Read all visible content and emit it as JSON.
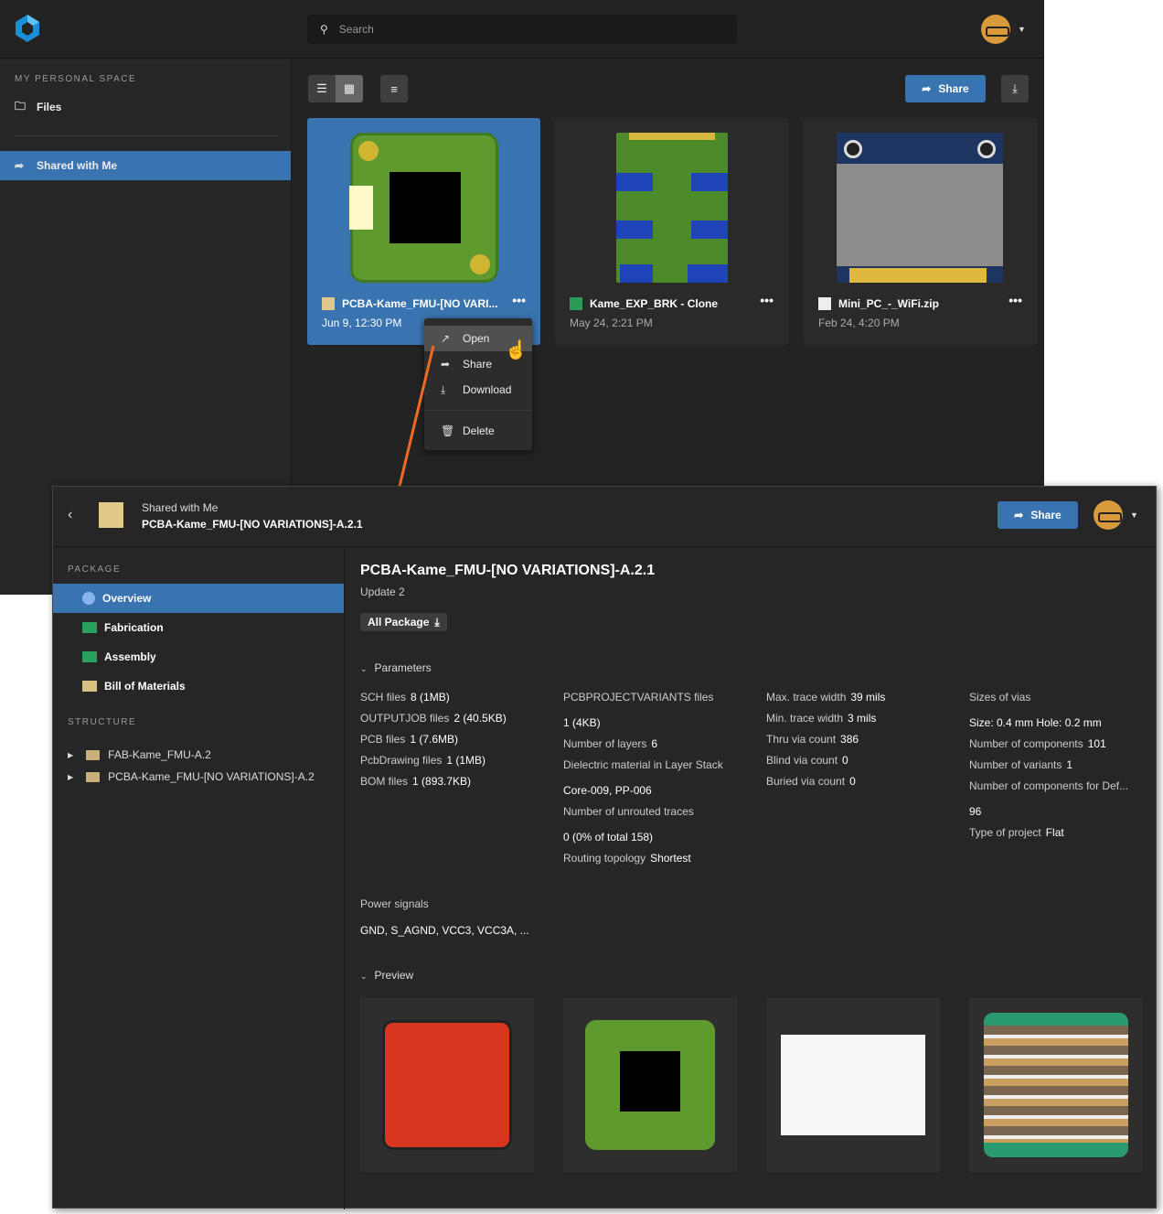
{
  "topbar": {
    "search_placeholder": "Search"
  },
  "sidebar": {
    "section": "MY PERSONAL SPACE",
    "files": "Files",
    "shared": "Shared with Me"
  },
  "toolbar": {
    "share": "Share"
  },
  "cards": [
    {
      "name": "PCBA-Kame_FMU-[NO VARI...",
      "date": "Jun 9, 12:30 PM",
      "selected": true
    },
    {
      "name": "Kame_EXP_BRK - Clone",
      "date": "May 24, 2:21 PM"
    },
    {
      "name": "Mini_PC_-_WiFi.zip",
      "date": "Feb 24, 4:20 PM"
    }
  ],
  "menu": [
    "Open",
    "Share",
    "Download",
    "Delete"
  ],
  "detail": {
    "breadcrumb_parent": "Shared with Me",
    "breadcrumb_title": "PCBA-Kame_FMU-[NO VARIATIONS]-A.2.1",
    "share": "Share",
    "package_label": "PACKAGE",
    "nav": [
      "Overview",
      "Fabrication",
      "Assembly",
      "Bill of Materials"
    ],
    "structure_label": "STRUCTURE",
    "tree": [
      "FAB-Kame_FMU-A.2",
      "PCBA-Kame_FMU-[NO VARIATIONS]-A.2"
    ],
    "title": "PCBA-Kame_FMU-[NO VARIATIONS]-A.2.1",
    "subtitle": "Update 2",
    "all_package": "All Package",
    "parameters_label": "Parameters",
    "preview_label": "Preview",
    "col1": [
      [
        "SCH files",
        "8 (1MB)"
      ],
      [
        "OUTPUTJOB files",
        "2 (40.5KB)"
      ],
      [
        "PCB files",
        "1 (7.6MB)"
      ],
      [
        "PcbDrawing files",
        "1 (1MB)"
      ],
      [
        "BOM files",
        "1 (893.7KB)"
      ]
    ],
    "col2": {
      "a_label": "PCBPROJECTVARIANTS files",
      "a_val": "1 (4KB)",
      "layers_label": "Number of layers",
      "layers_val": "6",
      "diel_label": "Dielectric material in Layer Stack",
      "diel_val": "Core-009, PP-006",
      "unrouted_label": "Number of unrouted traces",
      "unrouted_val": "0 (0% of total 158)",
      "topo_label": "Routing topology",
      "topo_val": "Shortest"
    },
    "col3": [
      [
        "Max. trace width",
        "39 mils"
      ],
      [
        "Min. trace width",
        "3 mils"
      ],
      [
        "Thru via count",
        "386"
      ],
      [
        "Blind via count",
        "0"
      ],
      [
        "Buried via count",
        "0"
      ]
    ],
    "col4": {
      "vias_label": "Sizes of vias",
      "vias_val": "Size: 0.4 mm Hole: 0.2 mm",
      "comp_label": "Number of components",
      "comp_val": "101",
      "var_label": "Number of variants",
      "var_val": "1",
      "def_label": "Number of components for Def...",
      "def_val": "96",
      "type_label": "Type of project",
      "type_val": "Flat"
    },
    "power_label": "Power signals",
    "power_val": "GND, S_AGND, VCC3, VCC3A, ..."
  },
  "colors": {
    "accent": "#3a74b0",
    "arrow": "#f06a25"
  }
}
